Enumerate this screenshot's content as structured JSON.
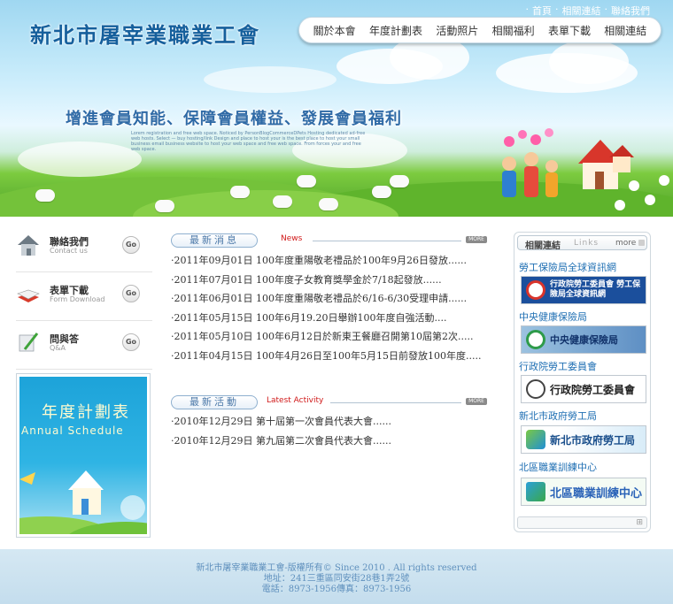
{
  "header": {
    "site_title": "新北市屠宰業職業工會",
    "top_links": [
      "首頁",
      "相關連結",
      "聯絡我們"
    ],
    "nav": [
      "關於本會",
      "年度計劃表",
      "活動照片",
      "相關福利",
      "表單下載",
      "相關連結"
    ],
    "slogan": "增進會員知能、保障會員權益、發展會員福利",
    "tagline": "Lorem registration and free web space. Noticed by PersonBlogCommerceDPets Hosting dedicated ad-free web hosts. Select — buy hosting/link Design and place to host your is the best place to host your small business email business website to host your web space and free web space. From forces your and free web space."
  },
  "quick_links": [
    {
      "title": "聯絡我們",
      "sub": "Contact us",
      "go": "Go",
      "icon": "house-icon"
    },
    {
      "title": "表單下載",
      "sub": "Form Download",
      "go": "Go",
      "icon": "book-icon"
    },
    {
      "title": "問與答",
      "sub": "Q&A",
      "go": "Go",
      "icon": "pen-icon"
    }
  ],
  "schedule": {
    "title": "年度計劃表",
    "subtitle": "Annual Schedule"
  },
  "news": {
    "heading": "最新消息",
    "heading_en": "News",
    "more": "MORE",
    "items": [
      "·2011年09月01日 100年度重陽敬老禮品於100年9月26日發放......",
      "·2011年07月01日 100年度子女教育獎學金於7/18起發放......",
      "·2011年06月01日 100年度重陽敬老禮品於6/16-6/30受理申請......",
      "·2011年05月15日 100年6月19.20日舉辦100年度自強活動....",
      "·2011年05月10日 100年6月12日於新東王餐廳召開第10屆第2次.....",
      "·2011年04月15日 100年4月26日至100年5月15日前發放100年度......"
    ]
  },
  "activities": {
    "heading": "最新活動",
    "heading_en": "Latest Activity",
    "more": "MORE",
    "items": [
      "·2010年12月29日 第十屆第一次會員代表大會......",
      "·2010年12月29日 第九屆第二次會員代表大會......"
    ]
  },
  "related": {
    "heading": "相關連結",
    "heading_en": "Links",
    "more": "more",
    "links": [
      {
        "name": "勞工保險局全球資訊網",
        "logo_text": "行政院勞工委員會 勞工保險局全球資訊網",
        "color": "#1b4f9c"
      },
      {
        "name": "中央健康保險局",
        "logo_text": "中央健康保險局",
        "color": "#2a5caa"
      },
      {
        "name": "行政院勞工委員會",
        "logo_text": "行政院勞工委員會",
        "color": "#ffffff"
      },
      {
        "name": "新北市政府勞工局",
        "logo_text": "新北市政府勞工局",
        "color": "#3a8bd0"
      },
      {
        "name": "北區職業訓練中心",
        "logo_text": "北區職業訓練中心",
        "color": "#ffffff"
      }
    ]
  },
  "footer": {
    "line1": "新北市屠宰業職業工會-版權所有© Since 2010 . All rights reserved",
    "line2": "地址：241三重區同安街28巷1弄2號",
    "line3": "電話：8973-1956傳真：8973-1956"
  }
}
